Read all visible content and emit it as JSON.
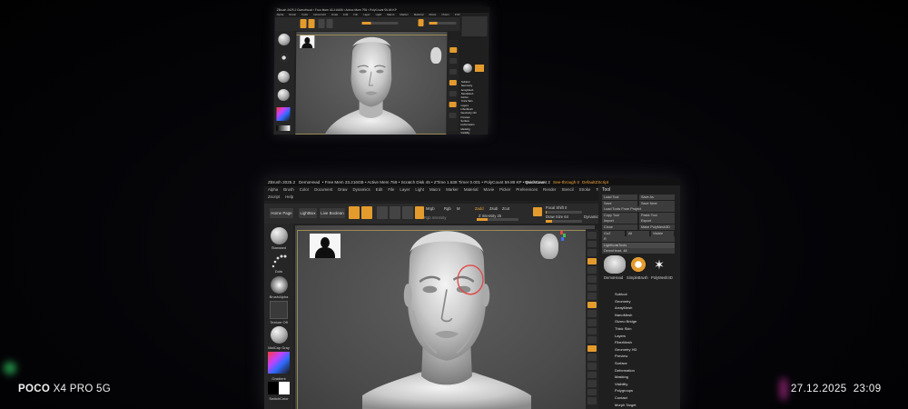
{
  "watermark": {
    "device_brand": "POCO",
    "device_model": "X4 PRO 5G",
    "datetime": "27.12.2025  23:09"
  },
  "main_monitor": {
    "title_bar": {
      "app_version": "ZBrush 2025.2",
      "document": "DemoHead",
      "mem_stats": "• Free Mem 33.216GB • Active Mem 759 • Scratch Disk 45 • ZTime 1.638 Timer 0.001 • PolyCount 59.88 KP • MeshCount 2",
      "quicksave": "QuickSave",
      "see_through": "See-through 0",
      "ui_layout": "DefaultZScript"
    },
    "menu": [
      "Alpha",
      "Brush",
      "Color",
      "Document",
      "Draw",
      "Dynamics",
      "Edit",
      "File",
      "Layer",
      "Light",
      "Macro",
      "Marker",
      "Material",
      "Movie",
      "Picker",
      "Preferences",
      "Render",
      "Stencil",
      "Stroke",
      "Texture",
      "Tool",
      "Transform",
      "Zplugin"
    ],
    "submenu": [
      "Zscript",
      "Help"
    ],
    "toolbar": {
      "home_page": "Home Page",
      "lightbox": "LightBox",
      "live_boolean": "Live Boolean",
      "edit": "Edit",
      "draw": "Draw",
      "move": "Move",
      "scale": "Scale",
      "rotate": "Rotate",
      "mrgb": "Mrgb",
      "rgb": "Rgb",
      "m": "M",
      "zadd": "Zadd",
      "zsub": "Zsub",
      "zcut": "Zcut",
      "rgb_intensity": "Rgb Intensity",
      "z_intensity": "Z Intensity 25",
      "z_intensity_value": 0.25,
      "focal_shift": "Focal Shift 0",
      "draw_size": "Draw Size 64",
      "dynamic": "Dynamic"
    },
    "shelf": {
      "brush": "Standard",
      "stroke": "Dots",
      "alpha": "BrushAlpha",
      "texture": "Texture Off",
      "material": "MatCap Gray",
      "gradient": "Gradient",
      "switch_color": "SwitchColor"
    },
    "palette": {
      "title": "Tool",
      "buttons": [
        "Load Tool",
        "Save As",
        "Save",
        "Save Next",
        "Load Tools From Project",
        "Copy Tool",
        "Paste Tool",
        "Import",
        "Export",
        "Clone",
        "Make PolyMesh3D",
        "GoZ",
        "All",
        "Visible",
        "R",
        "Lightbox▸Tools",
        "DemoHead. 48",
        "Sculpt To Pod"
      ],
      "tools": [
        "DemoHead",
        "SimpleBrush",
        "PolyMesh3D"
      ],
      "sections": [
        "Subtool",
        "Geometry",
        "ArrayMesh",
        "NanoMesh",
        "Gizmo Bridge",
        "Thick Skin",
        "Layers",
        "FiberMesh",
        "Geometry HD",
        "Preview",
        "Surface",
        "Deformation",
        "Masking",
        "Visibility",
        "Polygroups",
        "Contact",
        "Morph Target"
      ]
    },
    "right_tools": [
      "Bpr",
      "SPix 3",
      "Scroll",
      "Zoom",
      "Actual",
      "AAHalf",
      "Dynamic",
      "Persp",
      "Floor",
      "Local",
      "Frame",
      "Move",
      "Zoom3D",
      "Rotate",
      "Line Fill",
      "PolyF",
      "Transp",
      "Ghost",
      "Solo",
      "Xpose"
    ]
  },
  "top_monitor": {
    "title_bar": "ZBrush 2025.2  DemoHead  • Free Mem 33.216GB • Active Mem 759 • PolyCount 59.88 KP",
    "menu": [
      "Alpha",
      "Brush",
      "Color",
      "Document",
      "Draw",
      "Edit",
      "File",
      "Layer",
      "Light",
      "Macro",
      "Marker",
      "Material",
      "Movie",
      "Picker",
      "Preferences",
      "Render",
      "Stencil",
      "Stroke",
      "Texture",
      "Tool",
      "Transform",
      "Zplugin"
    ],
    "palette_sections": [
      "Subtool",
      "Geometry",
      "ArrayMesh",
      "NanoMesh",
      "Gizmo",
      "Thick Skin",
      "Layers",
      "FiberMesh",
      "Geometry HD",
      "Preview",
      "Surface",
      "Deformation",
      "Masking",
      "Visibility",
      "Polygroups",
      "Contact",
      "Morph Target"
    ]
  },
  "colors": {
    "accent_orange": "#e39b2e",
    "ui_dark": "#1f1f1f",
    "viewport_gray": "#525252",
    "watermark_text": "#f2f2f2"
  }
}
